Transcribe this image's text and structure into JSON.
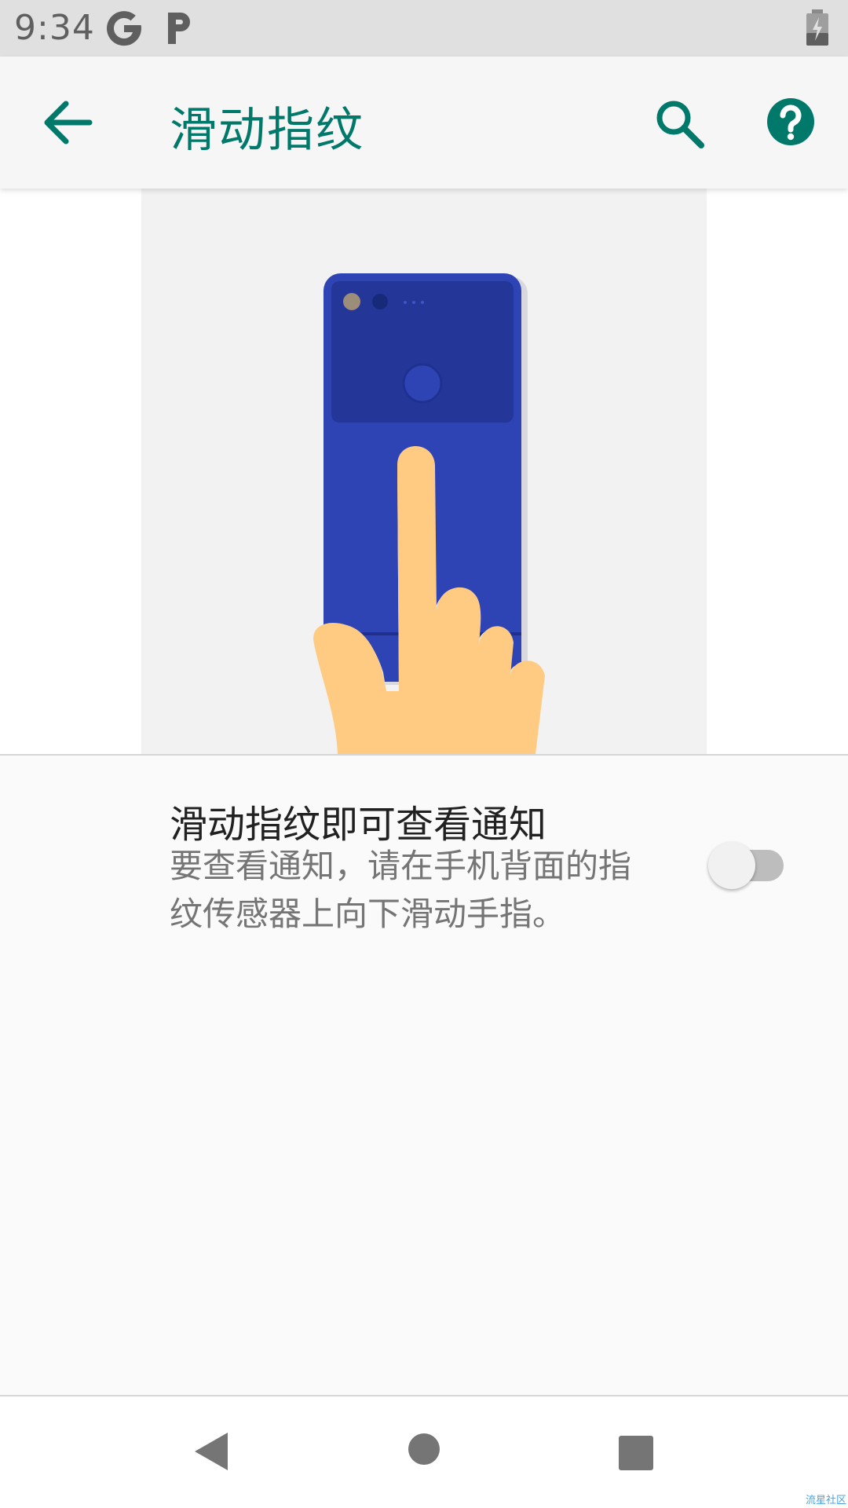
{
  "status_bar": {
    "time": "9:34",
    "icons": [
      "google-g-icon",
      "parking-p-icon",
      "battery-charging-icon"
    ]
  },
  "app_bar": {
    "title": "滑动指纹",
    "back_icon": "arrow-back-icon",
    "search_icon": "search-icon",
    "help_icon": "help-icon"
  },
  "setting": {
    "title": "滑动指纹即可查看通知",
    "summary": "要查看通知，请在手机背面的指纹传感器上向下滑动手指。",
    "toggle_on": false
  },
  "nav_bar": {
    "icons": [
      "nav-back-icon",
      "nav-home-icon",
      "nav-recents-icon"
    ]
  },
  "watermark": "流星社区",
  "colors": {
    "accent": "#00796b",
    "phone_blue": "#2e44b5",
    "finger": "#ffcb82"
  }
}
